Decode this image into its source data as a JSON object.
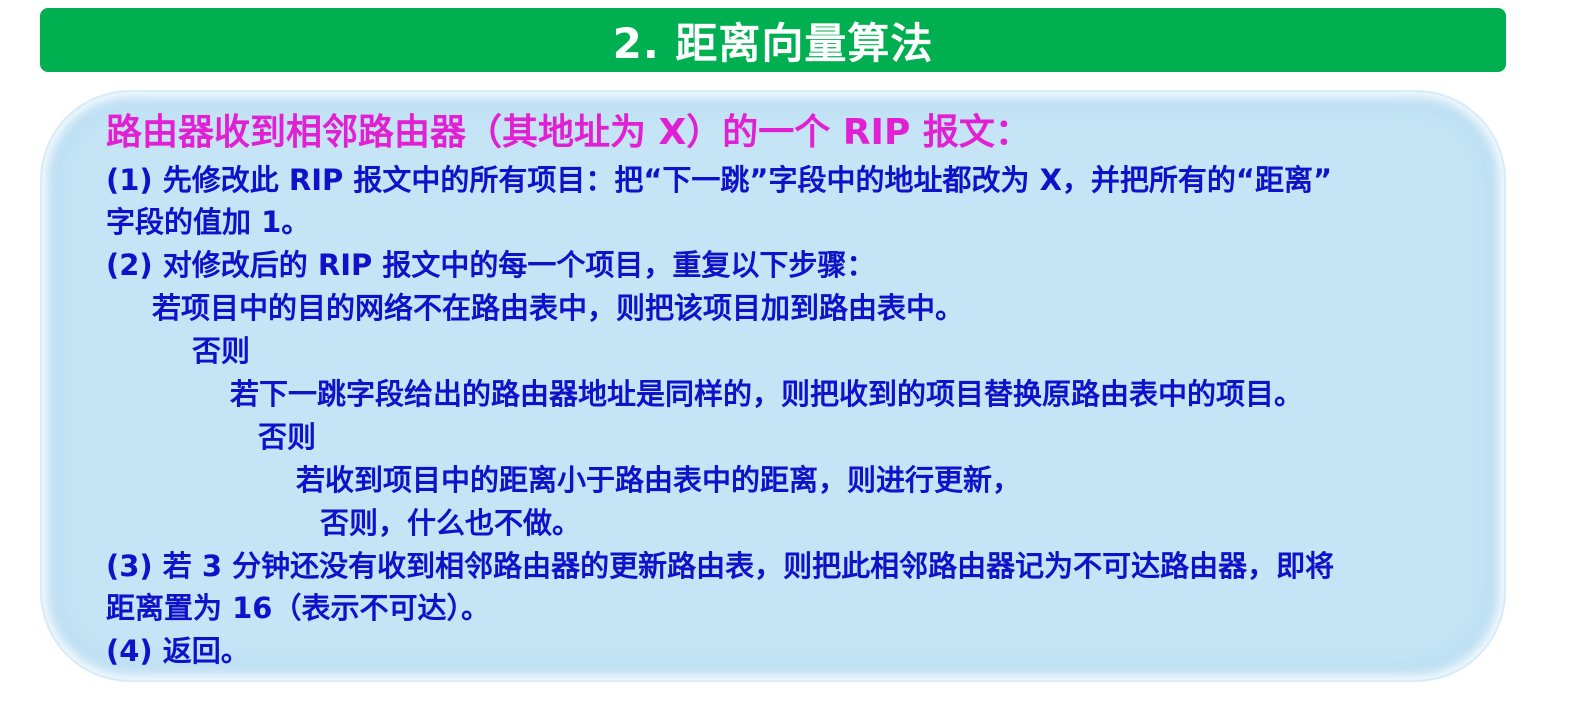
{
  "title": "2. 距离向量算法",
  "heading": "路由器收到相邻路由器（其地址为 X）的一个 RIP 报文：",
  "lines": [
    "(1) 先修改此 RIP 报文中的所有项目：把“下一跳”字段中的地址都改为 X，并把所有的“距离”",
    "字段的值加 1。",
    "(2) 对修改后的 RIP 报文中的每一个项目，重复以下步骤：",
    "若项目中的目的网络不在路由表中，则把该项目加到路由表中。",
    "否则",
    "若下一跳字段给出的路由器地址是同样的，则把收到的项目替换原路由表中的项目。",
    "否则",
    "若收到项目中的距离小于路由表中的距离，则进行更新，",
    "否则，什么也不做。",
    "(3) 若 3 分钟还没有收到相邻路由器的更新路由表，则把此相邻路由器记为不可达路由器，即将",
    "距离置为 16（表示不可达）。",
    "(4) 返回。"
  ],
  "colors": {
    "title_bg": "#00b050",
    "title_text": "#ffffff",
    "heading": "#e020d2",
    "body_text": "#0f12c9",
    "panel_bg": "#c5e4f6"
  }
}
